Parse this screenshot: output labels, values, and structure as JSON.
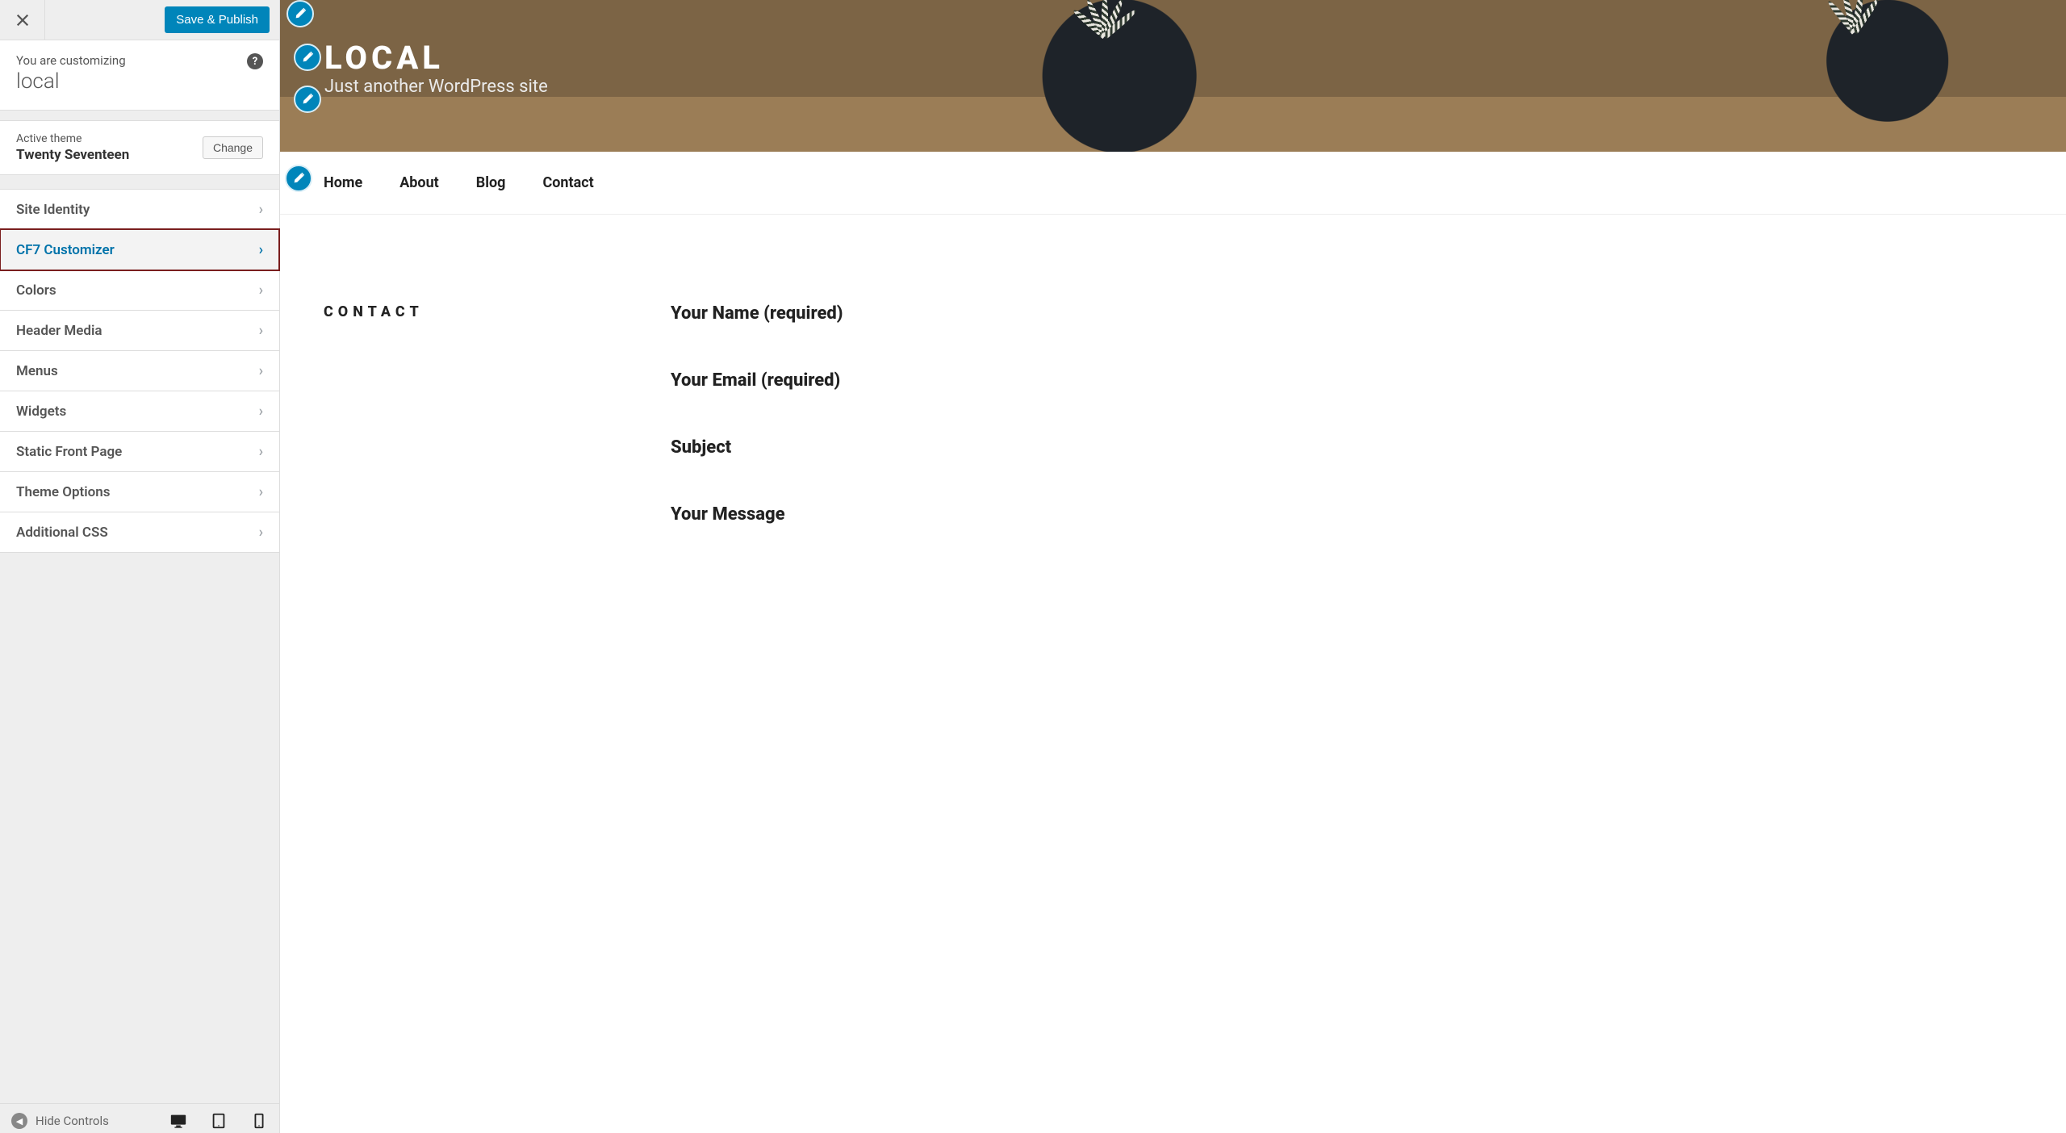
{
  "sidebar": {
    "save_button": "Save & Publish",
    "customizing_label": "You are customizing",
    "site_name": "local",
    "active_theme_label": "Active theme",
    "active_theme_name": "Twenty Seventeen",
    "change_button": "Change",
    "panels": [
      {
        "label": "Site Identity",
        "highlight": false
      },
      {
        "label": "CF7 Customizer",
        "highlight": true
      },
      {
        "label": "Colors",
        "highlight": false
      },
      {
        "label": "Header Media",
        "highlight": false
      },
      {
        "label": "Menus",
        "highlight": false
      },
      {
        "label": "Widgets",
        "highlight": false
      },
      {
        "label": "Static Front Page",
        "highlight": false
      },
      {
        "label": "Theme Options",
        "highlight": false
      },
      {
        "label": "Additional CSS",
        "highlight": false
      }
    ],
    "hide_controls": "Hide Controls"
  },
  "preview": {
    "site_title": "LOCAL",
    "tagline": "Just another WordPress site",
    "nav": [
      "Home",
      "About",
      "Blog",
      "Contact"
    ],
    "page_heading": "CONTACT",
    "form_labels": [
      "Your Name (required)",
      "Your Email (required)",
      "Subject",
      "Your Message"
    ]
  },
  "colors": {
    "accent": "#0085ba",
    "highlight_outline": "#7a1e1e"
  }
}
